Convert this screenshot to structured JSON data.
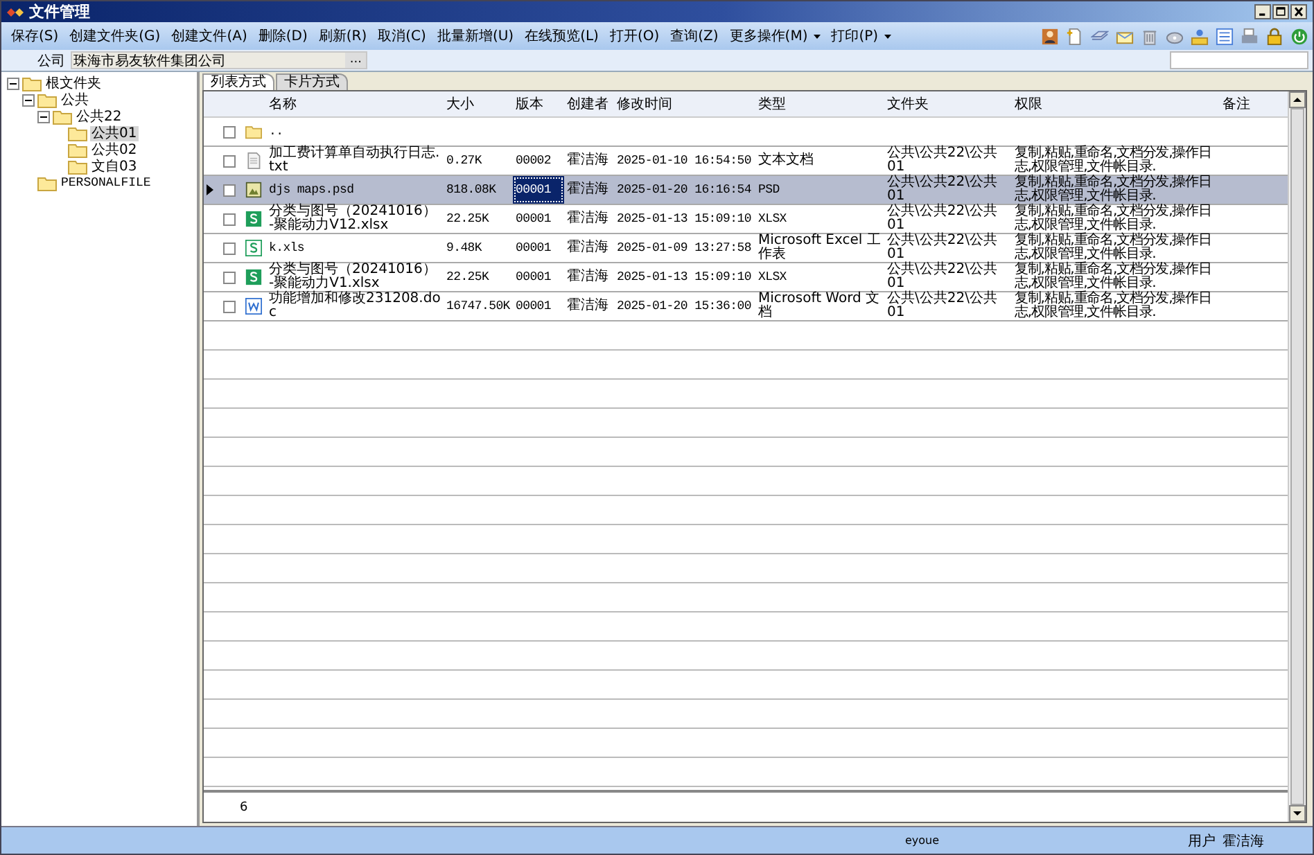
{
  "window": {
    "title": "文件管理"
  },
  "menu": [
    {
      "label": "保存(S)",
      "dropdown": false
    },
    {
      "label": "创建文件夹(G)",
      "dropdown": false
    },
    {
      "label": "创建文件(A)",
      "dropdown": false
    },
    {
      "label": "删除(D)",
      "dropdown": false
    },
    {
      "label": "刷新(R)",
      "dropdown": false
    },
    {
      "label": "取消(C)",
      "dropdown": false
    },
    {
      "label": "批量新增(U)",
      "dropdown": false
    },
    {
      "label": "在线预览(L)",
      "dropdown": false
    },
    {
      "label": "打开(O)",
      "dropdown": false
    },
    {
      "label": "查询(Z)",
      "dropdown": false
    },
    {
      "label": "更多操作(M)",
      "dropdown": true
    },
    {
      "label": "打印(P)",
      "dropdown": true
    }
  ],
  "company": {
    "label": "公司",
    "value": "珠海市易友软件集团公司",
    "button": "..."
  },
  "tree": [
    {
      "label": "根文件夹",
      "expanded": true,
      "selected": false,
      "children": [
        {
          "label": "公共",
          "expanded": true,
          "selected": false,
          "children": [
            {
              "label": "公共22",
              "expanded": true,
              "selected": false,
              "children": [
                {
                  "label": "公共01",
                  "selected": true
                },
                {
                  "label": "公共02",
                  "selected": false
                },
                {
                  "label": "文自03",
                  "selected": false
                }
              ]
            }
          ]
        },
        {
          "label": "PERSONALFILE",
          "selected": false
        }
      ]
    }
  ],
  "tabs": [
    {
      "label": "列表方式",
      "selected": true
    },
    {
      "label": "卡片方式",
      "selected": false
    }
  ],
  "table": {
    "columns": [
      "名称",
      "大小",
      "版本",
      "创建者",
      "修改时间",
      "类型",
      "文件夹",
      "权限",
      "备注"
    ],
    "rows": [
      {
        "kind": "folder",
        "checked": false,
        "selected": false,
        "name": ".."
      },
      {
        "kind": "text",
        "checked": false,
        "selected": false,
        "name": "加工费计算单自动执行日志.txt",
        "size": "0.27K",
        "version": "00002",
        "creator": "霍洁海",
        "modified": "2025-01-10 16:54:50",
        "type": "文本文档",
        "folder": "公共\\公共22\\公共01",
        "permissions": "复制,粘贴,重命名,文档分发,操作日志,权限管理,文件帐目录."
      },
      {
        "kind": "image",
        "checked": false,
        "selected": true,
        "version_focused": true,
        "name": "djs maps.psd",
        "size": "818.08K",
        "version": "00001",
        "creator": "霍洁海",
        "modified": "2025-01-20 16:16:54",
        "type": "PSD",
        "folder": "公共\\公共22\\公共01",
        "permissions": "复制,粘贴,重命名,文档分发,操作日志,权限管理,文件帐目录."
      },
      {
        "kind": "sheet",
        "checked": false,
        "selected": false,
        "name": "分类与图号（20241016）-聚能动力V12.xlsx",
        "size": "22.25K",
        "version": "00001",
        "creator": "霍洁海",
        "modified": "2025-01-13 15:09:10",
        "type": "XLSX",
        "folder": "公共\\公共22\\公共01",
        "permissions": "复制,粘贴,重命名,文档分发,操作日志,权限管理,文件帐目录."
      },
      {
        "kind": "sheet-outline",
        "checked": false,
        "selected": false,
        "name": "k.xls",
        "size": "9.48K",
        "version": "00001",
        "creator": "霍洁海",
        "modified": "2025-01-09 13:27:58",
        "type": "Microsoft Excel 工作表",
        "folder": "公共\\公共22\\公共01",
        "permissions": "复制,粘贴,重命名,文档分发,操作日志,权限管理,文件帐目录."
      },
      {
        "kind": "sheet",
        "checked": false,
        "selected": false,
        "name": "分类与图号（20241016）-聚能动力V1.xlsx",
        "size": "22.25K",
        "version": "00001",
        "creator": "霍洁海",
        "modified": "2025-01-13 15:09:10",
        "type": "XLSX",
        "folder": "公共\\公共22\\公共01",
        "permissions": "复制,粘贴,重命名,文档分发,操作日志,权限管理,文件帐目录."
      },
      {
        "kind": "word",
        "checked": false,
        "selected": false,
        "name": "功能增加和修改231208.doc",
        "size": "16747.50K",
        "version": "00001",
        "creator": "霍洁海",
        "modified": "2025-01-20 15:36:00",
        "type": "Microsoft Word 文档",
        "folder": "公共\\公共22\\公共01",
        "permissions": "复制,粘贴,重命名,文档分发,操作日志,权限管理,文件帐目录."
      }
    ],
    "footer_count": "6"
  },
  "status_bar": {
    "company_code": "eyoue",
    "user_label": "用户",
    "user": "霍洁海"
  }
}
